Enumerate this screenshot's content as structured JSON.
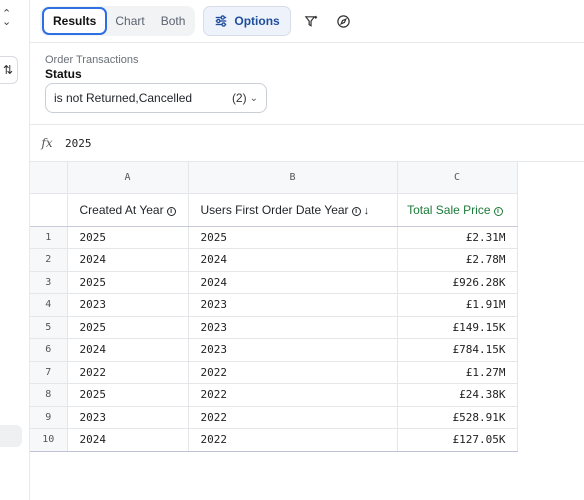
{
  "toolbar": {
    "tabs": [
      {
        "label": "Results",
        "active": true
      },
      {
        "label": "Chart",
        "active": false
      },
      {
        "label": "Both",
        "active": false
      }
    ],
    "options_label": "Options",
    "icons": [
      "sliders-icon",
      "filter-sparkle-icon",
      "compass-icon"
    ]
  },
  "filter": {
    "source": "Order Transactions",
    "field": "Status",
    "value": "is not Returned,Cancelled",
    "count": "(2)"
  },
  "formula": {
    "fx": "fx",
    "value": "2025"
  },
  "grid": {
    "column_letters": [
      "A",
      "B",
      "C"
    ],
    "columns": [
      {
        "label": "Created At Year",
        "has_info": true,
        "sort": ""
      },
      {
        "label": "Users First Order Date Year",
        "has_info": true,
        "sort": "↓"
      },
      {
        "label": "Total Sale Price",
        "has_info": true,
        "sort": ""
      }
    ],
    "rows": [
      {
        "n": "1",
        "a": "2025",
        "b": "2025",
        "c": "£2.31M"
      },
      {
        "n": "2",
        "a": "2024",
        "b": "2024",
        "c": "£2.78M"
      },
      {
        "n": "3",
        "a": "2025",
        "b": "2024",
        "c": "£926.28K"
      },
      {
        "n": "4",
        "a": "2023",
        "b": "2023",
        "c": "£1.91M"
      },
      {
        "n": "5",
        "a": "2025",
        "b": "2023",
        "c": "£149.15K"
      },
      {
        "n": "6",
        "a": "2024",
        "b": "2023",
        "c": "£784.15K"
      },
      {
        "n": "7",
        "a": "2022",
        "b": "2022",
        "c": "£1.27M"
      },
      {
        "n": "8",
        "a": "2025",
        "b": "2022",
        "c": "£24.38K"
      },
      {
        "n": "9",
        "a": "2023",
        "b": "2022",
        "c": "£528.91K"
      },
      {
        "n": "10",
        "a": "2024",
        "b": "2022",
        "c": "£127.05K"
      }
    ]
  },
  "colors": {
    "accent": "#2f6fe4",
    "measure_header": "#1c7a3a"
  }
}
